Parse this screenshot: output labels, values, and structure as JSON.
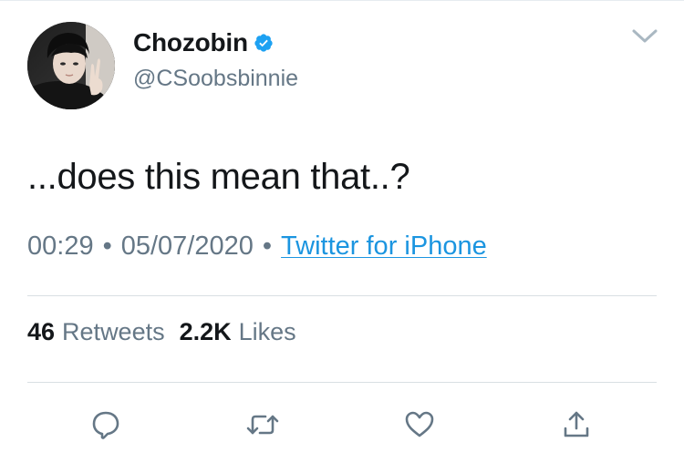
{
  "author": {
    "display_name": "Chozobin",
    "handle": "@CSoobsbinnie",
    "verified": true
  },
  "tweet": {
    "text": "...does this mean that..?",
    "time": "00:29",
    "date": "05/07/2020",
    "separator": "•",
    "source": "Twitter for iPhone"
  },
  "stats": {
    "retweets_count": "46",
    "retweets_label": "Retweets",
    "likes_count": "2.2K",
    "likes_label": "Likes"
  },
  "icons": {
    "verified": "verified-badge-icon",
    "menu": "chevron-down-icon",
    "reply": "reply-icon",
    "retweet": "retweet-icon",
    "like": "heart-icon",
    "share": "share-icon"
  },
  "colors": {
    "link": "#1b95e0",
    "verified": "#1da1f2",
    "secondary_text": "#657786",
    "primary_text": "#14171a"
  }
}
